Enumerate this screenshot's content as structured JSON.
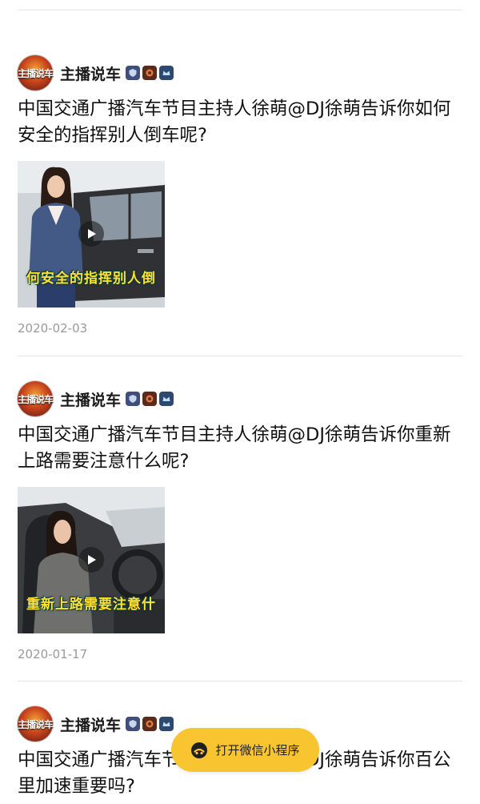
{
  "posts": [
    {
      "author": "主播说车",
      "avatar_text": "主播说车",
      "title": "中国交通广播汽车节目主持人徐萌@DJ徐萌告诉你如何安全的指挥别人倒车呢?",
      "video_caption": "何安全的指挥别人倒",
      "date": "2020-02-03"
    },
    {
      "author": "主播说车",
      "avatar_text": "主播说车",
      "title": "中国交通广播汽车节目主持人徐萌@DJ徐萌告诉你重新上路需要注意什么呢?",
      "video_caption": "重新上路需要注意什",
      "date": "2020-01-17"
    },
    {
      "author": "主播说车",
      "avatar_text": "主播说车",
      "title": "中国交通广播汽车节目主持人徐萌@DJ徐萌告诉你百公里加速重要吗?"
    }
  ],
  "open_miniprogram_button": {
    "label": "打开微信小程序",
    "icon": "miniprogram-icon"
  },
  "colors": {
    "button_bg": "#f8c430",
    "caption": "#ffe033",
    "date": "#9a9a9a",
    "divider": "#e6e6e6"
  }
}
